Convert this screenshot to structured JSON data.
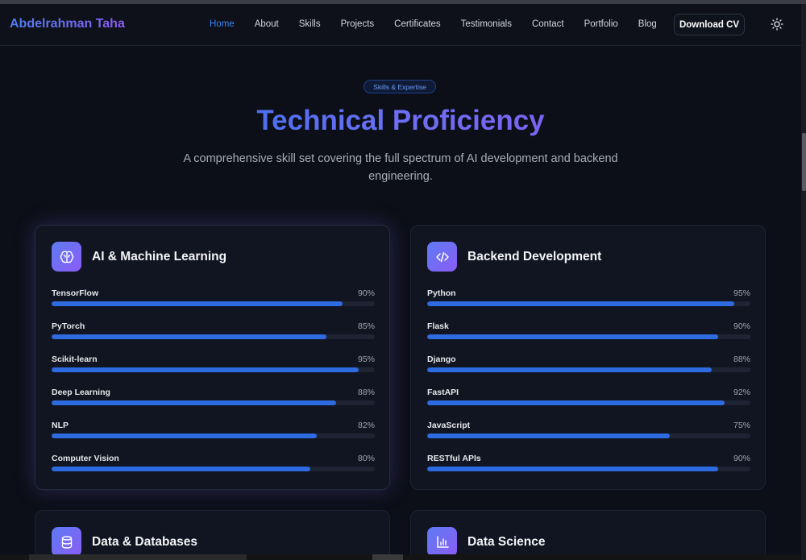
{
  "nav": {
    "brand": "Abdelrahman Taha",
    "links": [
      "Home",
      "About",
      "Skills",
      "Projects",
      "Certificates",
      "Testimonials",
      "Contact",
      "Portfolio",
      "Blog"
    ],
    "active": "Home",
    "cv_button": "Download CV",
    "theme_icon": "sun-icon"
  },
  "hero": {
    "badge": "Skills & Expertise",
    "title": "Technical Proficiency",
    "subtitle": "A comprehensive skill set covering the full spectrum of AI development and backend engineering."
  },
  "cards": [
    {
      "title": "AI & Machine Learning",
      "icon": "brain-icon",
      "skills": [
        {
          "name": "TensorFlow",
          "pct_label": "90%",
          "value": 90
        },
        {
          "name": "PyTorch",
          "pct_label": "85%",
          "value": 85
        },
        {
          "name": "Scikit-learn",
          "pct_label": "95%",
          "value": 95
        },
        {
          "name": "Deep Learning",
          "pct_label": "88%",
          "value": 88
        },
        {
          "name": "NLP",
          "pct_label": "82%",
          "value": 82
        },
        {
          "name": "Computer Vision",
          "pct_label": "80%",
          "value": 80
        }
      ]
    },
    {
      "title": "Backend Development",
      "icon": "code-icon",
      "skills": [
        {
          "name": "Python",
          "pct_label": "95%",
          "value": 95
        },
        {
          "name": "Flask",
          "pct_label": "90%",
          "value": 90
        },
        {
          "name": "Django",
          "pct_label": "88%",
          "value": 88
        },
        {
          "name": "FastAPI",
          "pct_label": "92%",
          "value": 92
        },
        {
          "name": "JavaScript",
          "pct_label": "75%",
          "value": 75
        },
        {
          "name": "RESTful APIs",
          "pct_label": "90%",
          "value": 90
        }
      ]
    },
    {
      "title": "Data & Databases",
      "icon": "database-icon"
    },
    {
      "title": "Data Science",
      "icon": "bar-chart-icon"
    }
  ],
  "colors": {
    "accent": "#3b82f6",
    "bar_fill": "#2e6ae0",
    "gradient_start": "#4f6ef0",
    "gradient_end": "#8b5cf6",
    "background": "#0c0f17"
  }
}
